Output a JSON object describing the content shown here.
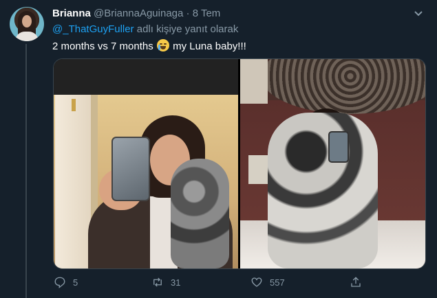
{
  "tweet": {
    "name": "Brianna",
    "handle": "@BriannaAguinaga",
    "separator": "·",
    "date": "8 Tem",
    "reply_mention": "@_ThatGuyFuller",
    "reply_suffix": " adlı kişiye yanıt olarak",
    "text_before_emoji": "2 months vs 7 months ",
    "emoji": "crying-face-emoji",
    "text_after_emoji": " my Luna baby!!!"
  },
  "actions": {
    "reply_count": "5",
    "retweet_count": "31",
    "like_count": "557"
  },
  "colors": {
    "background": "#15202b",
    "text": "#ffffff",
    "muted": "#8899a6",
    "link": "#1da1f2",
    "border": "#38444d"
  },
  "icons": [
    "chevron-down-icon",
    "reply-icon",
    "retweet-icon",
    "like-icon",
    "share-icon"
  ]
}
